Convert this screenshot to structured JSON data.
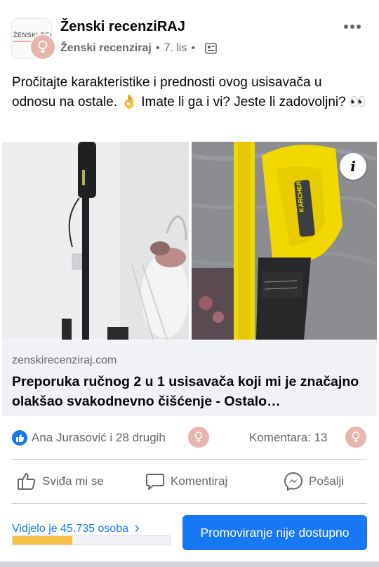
{
  "post": {
    "page_name": "Ženski recenziRAJ",
    "author": "Ženski recenziraj",
    "time": "7. lis",
    "logo_text": "ŽENSKI REC",
    "text": "Pročitajte karakteristike i prednosti ovog usisavača u odnosu na ostale. 👌 Imate li ga i vi? Jeste li zadovoljni? 👀"
  },
  "link": {
    "domain": "zenskirecenziraj.com",
    "title": "Preporuka ručnog 2 u 1 usisavača koji mi je značajno olakšao svakodnevno čišćenje - Ostalo…",
    "product_brand": "KÄRCHER"
  },
  "reactions": {
    "text": "Ana Jurasović i 28 drugih",
    "comments": "Komentara: 13"
  },
  "actions": {
    "like": "Sviđa mi se",
    "comment": "Komentiraj",
    "share": "Pošalji"
  },
  "footer": {
    "views": "Vidjelo je 45.735 osoba",
    "views_chevron": "›",
    "progress_fraction": 0.38,
    "promote": "Promoviranje nije dostupno"
  },
  "colors": {
    "accent": "#1877f2",
    "progress": "#f7b928",
    "avatar": "#e6b5ae"
  }
}
